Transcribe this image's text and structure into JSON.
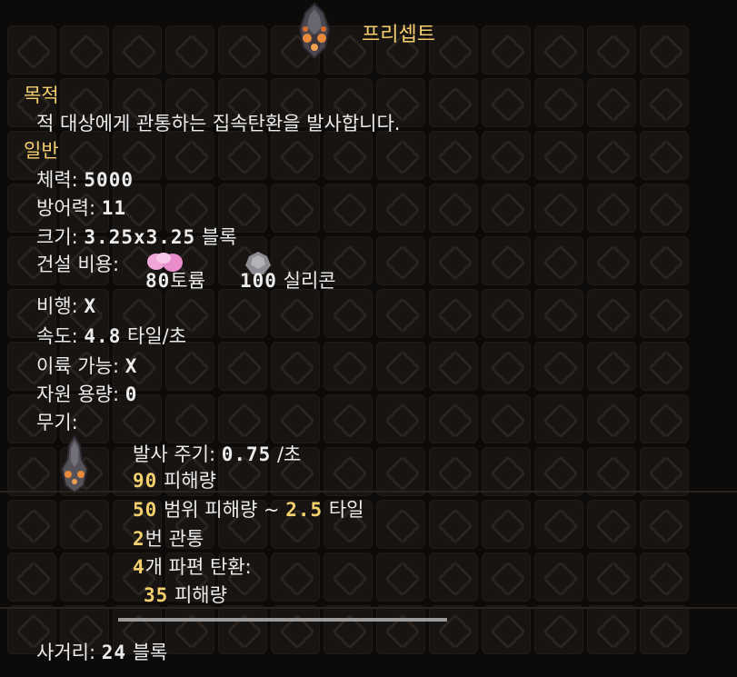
{
  "header": {
    "title": "프리셉트"
  },
  "purpose": {
    "heading": "목적",
    "text": "적 대상에게 관통하는 집속탄환을 발사합니다."
  },
  "general": {
    "heading": "일반",
    "health_label": "체력:",
    "health_value": "5000",
    "armor_label": "방어력:",
    "armor_value": "11",
    "size_label": "크기:",
    "size_value": "3.25x3.25",
    "size_unit": "블록",
    "cost_label": "건설 비용:",
    "cost_items": [
      {
        "amount": "80",
        "name": "토륨",
        "icon": "thorium-icon",
        "color": "#f2a6d8"
      },
      {
        "amount": "100",
        "name": "실리콘",
        "icon": "silicon-icon",
        "color": "#9a9aa0"
      }
    ],
    "flying_label": "비행:",
    "flying_value": "X",
    "speed_label": "속도:",
    "speed_value": "4.8",
    "speed_unit": "타일/초",
    "takeoff_label": "이륙 가능:",
    "takeoff_value": "X",
    "capacity_label": "자원 용량:",
    "capacity_value": "0",
    "weapons_label": "무기:"
  },
  "weapon": {
    "reload_label": "발사 주기:",
    "reload_value": "0.75",
    "reload_unit": "/초",
    "damage_value": "90",
    "damage_label": "피해량",
    "splash_value": "50",
    "splash_label": "범위 피해량 ~",
    "splash_radius": "2.5",
    "splash_unit": "타일",
    "pierce_value": "2",
    "pierce_label": "번 관통",
    "frag_value": "4",
    "frag_label": "개 파편 탄환:",
    "frag_damage_value": "35",
    "frag_damage_label": "피해량"
  },
  "range": {
    "label": "사거리:",
    "value": "24",
    "unit": "블록"
  },
  "colors": {
    "accent": "#f4cf6e",
    "text": "#ececec",
    "background": "#0d0b0a"
  }
}
